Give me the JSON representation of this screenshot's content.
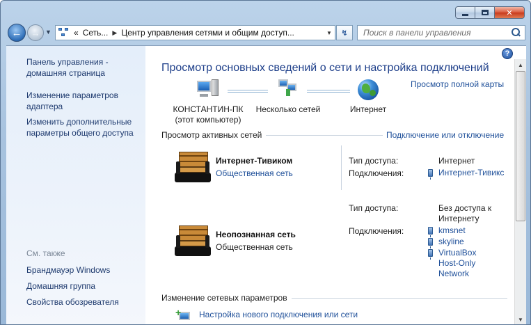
{
  "window": {
    "caption": {
      "minimize": "minimize",
      "maximize": "maximize",
      "close": "✕"
    }
  },
  "address": {
    "prefix": "«",
    "crumbs": [
      "Сеть...",
      "Центр управления сетями и общим доступ..."
    ],
    "separator": "▶"
  },
  "search": {
    "placeholder": "Поиск в панели управления"
  },
  "sidebar": {
    "home_line1": "Панель управления -",
    "home_line2": "домашняя страница",
    "adapter_line1": "Изменение параметров",
    "adapter_line2": "адаптера",
    "sharing_line1": "Изменить дополнительные",
    "sharing_line2": "параметры общего доступа",
    "see_also": "См. также",
    "firewall": "Брандмауэр Windows",
    "homegroup": "Домашняя группа",
    "browser_options": "Свойства обозревателя"
  },
  "main": {
    "title": "Просмотр основных сведений о сети и настройка подключений",
    "full_map": "Просмотр полной карты",
    "map": {
      "computer_name": "КОНСТАНТИН-ПК",
      "computer_sub": "(этот компьютер)",
      "multiple": "Несколько сетей",
      "internet": "Интернет"
    },
    "active_header": "Просмотр активных сетей",
    "connect_link": "Подключение или отключение",
    "networks": [
      {
        "name": "Интернет-Тивиком",
        "category": "Общественная сеть",
        "access_label": "Тип доступа:",
        "access_value": "Интернет",
        "conn_label": "Подключения:",
        "connections": [
          "Интернет-Тивикс"
        ]
      },
      {
        "name": "Неопознанная сеть",
        "category": "Общественная сеть",
        "access_label": "Тип доступа:",
        "access_value_line1": "Без доступа к",
        "access_value_line2": "Интернету",
        "conn_label": "Подключения:",
        "connections": [
          "kmsnet",
          "skyline",
          "VirtualBox",
          "Host-Only",
          "Network"
        ]
      }
    ],
    "change_header": "Изменение сетевых параметров",
    "setup_link": "Настройка нового подключения или сети"
  },
  "colors": {
    "link": "#1e4f99",
    "title": "#1e3f8a",
    "sidebar": "#e4eefa"
  }
}
